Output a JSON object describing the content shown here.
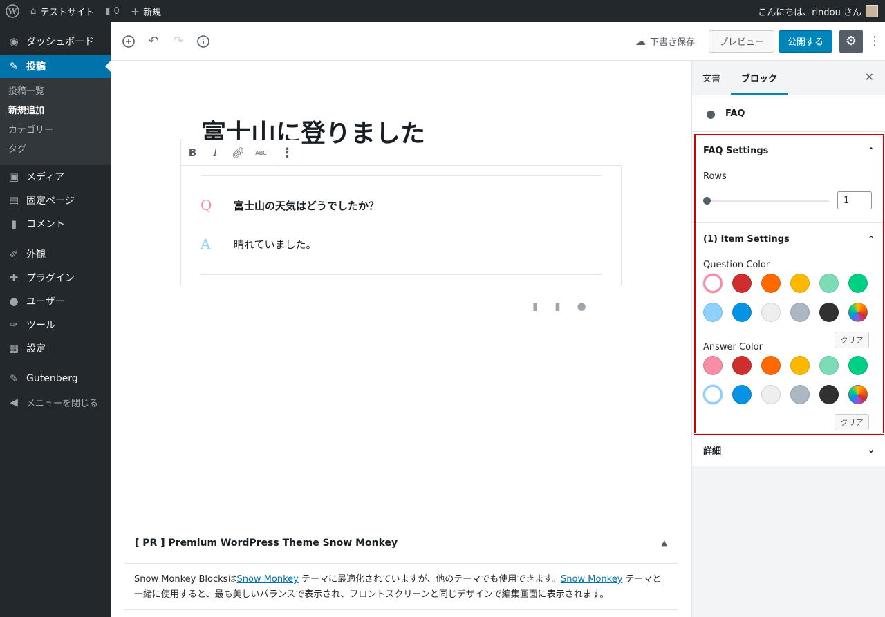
{
  "adminbar": {
    "site_name": "テストサイト",
    "comments_count": "0",
    "new_label": "新規",
    "greeting": "こんにちは、rindou さん"
  },
  "sidebar": {
    "dashboard": "ダッシュボード",
    "posts": "投稿",
    "posts_sub": [
      "投稿一覧",
      "新規追加",
      "カテゴリー",
      "タグ"
    ],
    "media": "メディア",
    "pages": "固定ページ",
    "comments": "コメント",
    "appearance": "外観",
    "plugins": "プラグイン",
    "users": "ユーザー",
    "tools": "ツール",
    "settings": "設定",
    "gutenberg": "Gutenberg",
    "collapse": "メニューを閉じる"
  },
  "header": {
    "save_draft": "下書き保存",
    "preview": "プレビュー",
    "publish": "公開する"
  },
  "post": {
    "title": "富士山に登りました",
    "toolbar": {
      "bold": "B",
      "italic": "I",
      "strikethrough": "ABC"
    },
    "faq": {
      "q_label": "Q",
      "question": "富士山の天気はどうでしたか？",
      "q_color": "#f78da7",
      "a_label": "A",
      "answer": "晴れていました。",
      "a_color": "#8ed1fc"
    }
  },
  "pr": {
    "title": "[ PR ] Premium WordPress Theme Snow Monkey",
    "text_1": "Snow Monkey Blocksは",
    "link_1": "Snow Monkey",
    "text_2": " テーマに最適化されていますが、他のテーマでも使用できます。",
    "link_2": "Snow Monkey",
    "text_3": " テーマと一緒に使用すると、最も美しいバランスで表示され、フロントスクリーンと同じデザインで編集画面に表示されます。"
  },
  "settings": {
    "tab_document": "文書",
    "tab_block": "ブロック",
    "block_name": "FAQ",
    "faq_settings": {
      "title": "FAQ Settings",
      "rows_label": "Rows",
      "rows_value": "1"
    },
    "item_settings": {
      "title": "(1) Item Settings",
      "question_color_label": "Question Color",
      "answer_color_label": "Answer Color",
      "clear_label": "クリア",
      "question_selected": "#f78da7",
      "answer_selected": "#8ed1fc"
    },
    "palette": [
      "#f78da7",
      "#cf2e2e",
      "#ff6900",
      "#fcb900",
      "#7bdcb5",
      "#00d084",
      "#8ed1fc",
      "#0693e3",
      "#eeeeee",
      "#abb8c3",
      "#313131",
      "gradient"
    ],
    "details": "詳細"
  }
}
